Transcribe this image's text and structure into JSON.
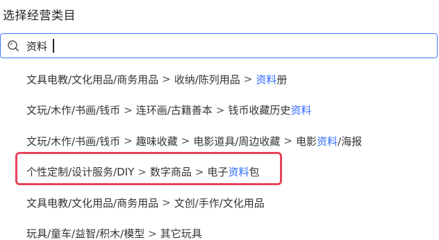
{
  "title": "选择经营类目",
  "search": {
    "value": "资料",
    "icon": "search-icon"
  },
  "results": [
    {
      "path": [
        "文具电教/文化用品/商务用品",
        "收纳/陈列用品"
      ],
      "last_before": "",
      "last_match": "资料",
      "last_after": "册"
    },
    {
      "path": [
        "文玩/木作/书画/钱币",
        "连环画/古籍善本"
      ],
      "last_before": "钱币收藏历史",
      "last_match": "资料",
      "last_after": ""
    },
    {
      "path": [
        "文玩/木作/书画/钱币",
        "趣味收藏",
        "电影道具/周边收藏"
      ],
      "last_before": "电影",
      "last_match": "资料",
      "last_after": "/海报"
    },
    {
      "path": [
        "个性定制/设计服务/DIY",
        "数字商品"
      ],
      "last_before": "电子",
      "last_match": "资料",
      "last_after": "包"
    },
    {
      "path": [
        "文具电教/文化用品/商务用品"
      ],
      "last_before": "文创/手作/文化用品",
      "last_match": "",
      "last_after": ""
    },
    {
      "path": [
        "玩具/童车/益智/积木/模型"
      ],
      "last_before": "其它玩具",
      "last_match": "",
      "last_after": ""
    }
  ],
  "separator": ">",
  "colors": {
    "match_highlight": "#2f6bff",
    "focus_border": "#3b77ff",
    "annotation_box": "#e8425a"
  }
}
